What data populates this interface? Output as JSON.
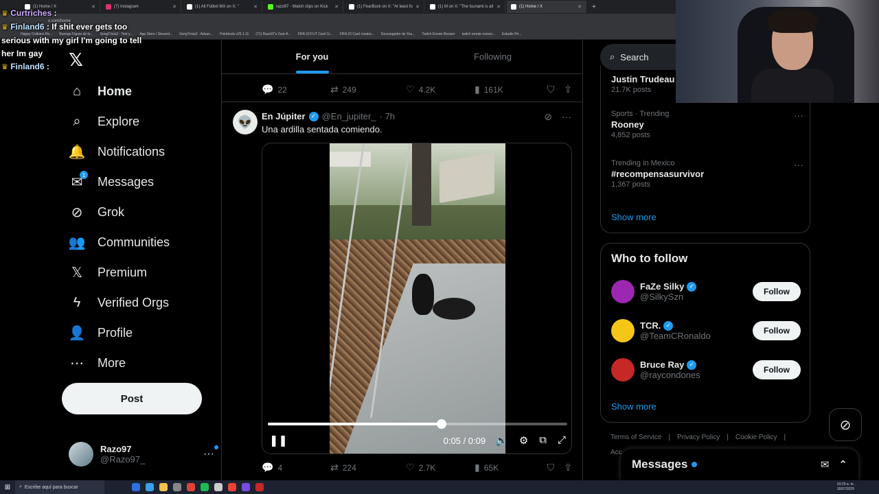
{
  "browser": {
    "tabs": [
      {
        "label": "(1) Home / X",
        "color": "#ffffff"
      },
      {
        "label": "(7) Instagram",
        "color": "#e1306c"
      },
      {
        "label": "(1) All Fútbol MX on X: \"",
        "color": "#ffffff"
      },
      {
        "label": "razo97 - Watch clips on Kick",
        "color": "#53fc18"
      },
      {
        "label": "(1) FearBuck on X: \"At least fo",
        "color": "#ffffff"
      },
      {
        "label": "(1) M on X: \"The tsunami is all",
        "color": "#ffffff"
      },
      {
        "label": "(1) Home / X",
        "color": "#ffffff",
        "active": true
      }
    ],
    "url": "x.com/home",
    "bookmarks": [
      "Happy Civilians Ro...",
      "Bunego Figure de lo...",
      "SongTrivia2 - Test y...",
      "App Store / Streaml...",
      "SongTrivia2 - Advan...",
      "Pokétools v25.1.11",
      "(71) Razo97's Zest-A...",
      "FIFA 23 FUT Card Cr...",
      "FIFA 23 Card creator...",
      "Descargador de You...",
      "Twitch Emote Resizer",
      "twitch emote resizer...",
      "Estudio Pri..."
    ]
  },
  "chat": [
    {
      "user": "Curtriches",
      "sep": " :",
      "msg": "",
      "color": "purple"
    },
    {
      "user": "Finland6",
      "sep": " :",
      "msg": " If shit ever gets too serious with my girl I'm going to tell her Im gay",
      "color": "blue"
    },
    {
      "user": "Finland6",
      "sep": " :",
      "msg": "",
      "color": "blue"
    }
  ],
  "nav": {
    "items": [
      {
        "label": "Home",
        "icon": "home-icon",
        "glyph": "⌂"
      },
      {
        "label": "Explore",
        "icon": "search-icon",
        "glyph": "⌕"
      },
      {
        "label": "Notifications",
        "icon": "bell-icon",
        "glyph": "🔔"
      },
      {
        "label": "Messages",
        "icon": "envelope-icon",
        "glyph": "✉",
        "badge": "1"
      },
      {
        "label": "Grok",
        "icon": "grok-icon",
        "glyph": "⊘"
      },
      {
        "label": "Communities",
        "icon": "people-icon",
        "glyph": "👥"
      },
      {
        "label": "Premium",
        "icon": "x-logo-icon",
        "glyph": "𝕏"
      },
      {
        "label": "Verified Orgs",
        "icon": "lightning-icon",
        "glyph": "ϟ"
      },
      {
        "label": "Profile",
        "icon": "person-icon",
        "glyph": "👤"
      },
      {
        "label": "More",
        "icon": "more-circle-icon",
        "glyph": "⋯"
      }
    ],
    "post_label": "Post",
    "account": {
      "name": "Razo97",
      "handle": "@Razo97_"
    }
  },
  "feed": {
    "tabs": [
      "For you",
      "Following"
    ],
    "prev_tweet_stats": {
      "replies": "22",
      "reposts": "249",
      "likes": "4.2K",
      "views": "161K"
    },
    "tweet": {
      "author": "En Júpiter",
      "handle": "@En_jupiter_",
      "time": "· 7h",
      "text": "Una ardilla sentada comiendo.",
      "video": {
        "time": "0:05 / 0:09",
        "progress": 0.58
      },
      "stats": {
        "replies": "4",
        "reposts": "224",
        "likes": "2.7K",
        "views": "65K"
      }
    }
  },
  "sidebar": {
    "search_placeholder": "Search",
    "trends": [
      {
        "context": "",
        "title": "Justin Trudeau",
        "count": "21.7K posts"
      },
      {
        "context": "Sports · Trending",
        "title": "Rooney",
        "count": "4,852 posts"
      },
      {
        "context": "Trending in Mexico",
        "title": "#recompensasurvivor",
        "count": "1,367 posts"
      }
    ],
    "show_more": "Show more",
    "who_to_follow": {
      "title": "Who to follow",
      "accounts": [
        {
          "name": "FaZe Silky",
          "handle": "@SilkySzn",
          "color": "#9c27b0"
        },
        {
          "name": "TCR.",
          "handle": "@TeamCRonaldo",
          "color": "#f5c518"
        },
        {
          "name": "Bruce Ray",
          "handle": "@raycondones",
          "color": "#c62828"
        }
      ],
      "follow_label": "Follow",
      "show_more": "Show more"
    },
    "footer": [
      "Terms of Service",
      "Privacy Policy",
      "Cookie Policy"
    ],
    "footer2": "Acc",
    "messages_label": "Messages"
  },
  "taskbar": {
    "search_placeholder": "Escribe aquí para buscar",
    "time": "03:29 a. m.",
    "date": "30/07/2025"
  },
  "colors": {
    "accent": "#1d9bf0",
    "bg": "#000000"
  }
}
